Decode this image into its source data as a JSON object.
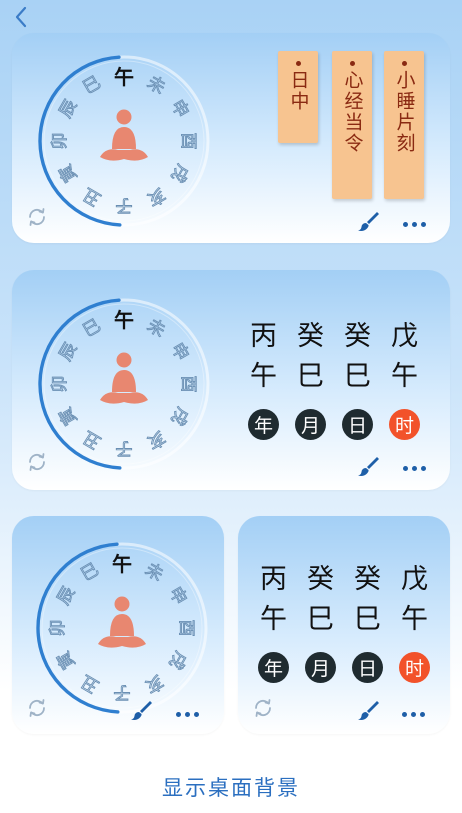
{
  "nav": {
    "back_icon": "chevron-left-icon"
  },
  "dial": {
    "branches": [
      "子",
      "丑",
      "寅",
      "卯",
      "辰",
      "巳",
      "午",
      "未",
      "申",
      "酉",
      "戌",
      "亥"
    ],
    "current": "午",
    "ring_color": "#2f7fd0",
    "figure_color": "#e88770",
    "figure_icon": "meditation-figure-icon"
  },
  "card1": {
    "tags": [
      {
        "text": "日中"
      },
      {
        "text": "心经当令"
      },
      {
        "text": "小睡片刻"
      }
    ]
  },
  "pillars": {
    "stems": [
      "丙",
      "癸",
      "癸",
      "戊"
    ],
    "branches": [
      "午",
      "巳",
      "巳",
      "午"
    ],
    "badges": [
      "年",
      "月",
      "日",
      "时"
    ],
    "active_badge": "时",
    "active_color": "#f2522a"
  },
  "footer": {
    "show_desktop_bg": "显示桌面背景"
  }
}
